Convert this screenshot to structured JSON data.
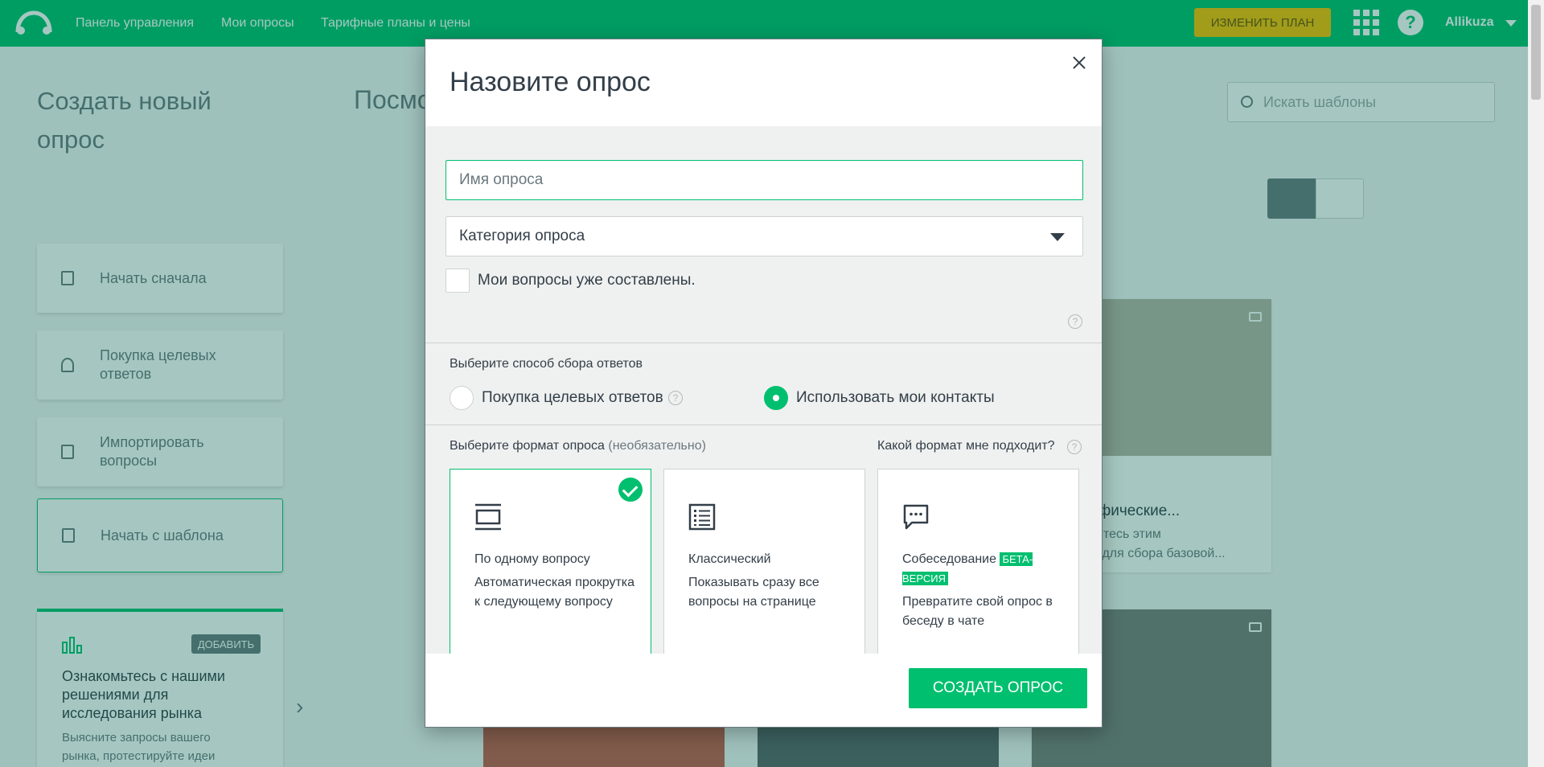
{
  "topbar": {
    "nav": [
      "Панель управления",
      "Мои опросы",
      "Тарифные планы и цены"
    ],
    "upgrade_label": "ИЗМЕНИТЬ ПЛАН",
    "help_label": "?",
    "user_name": "Allikuza"
  },
  "sidebar": {
    "title": "Создать новый опрос",
    "items": [
      {
        "label": "Начать сначала"
      },
      {
        "label": "Покупка целевых ответов"
      },
      {
        "label": "Импортировать вопросы"
      },
      {
        "label": "Начать с шаблона"
      }
    ],
    "market": {
      "badge": "ДОБАВИТЬ",
      "title": "Ознакомьтесь с нашими решениями для исследования рынка",
      "desc": "Выясните запросы вашего рынка, протестируйте идеи"
    }
  },
  "main": {
    "title": "Посмо",
    "search_placeholder": "Искать шаблоны",
    "template": {
      "name": "афические...",
      "desc_line1": "уйтесь этим",
      "desc_line2": "м для сбора базовой..."
    }
  },
  "modal": {
    "title": "Назовите опрос",
    "name_placeholder": "Имя опроса",
    "category_label": "Категория опроса",
    "own_questions_label": "Мои вопросы уже составлены.",
    "collect_label": "Выберите способ сбора ответов",
    "collect_options": [
      {
        "label": "Покупка целевых ответов",
        "checked": false
      },
      {
        "label": "Использовать мои контакты",
        "checked": true
      }
    ],
    "format_label": "Выберите формат опроса",
    "format_optional": "(необязательно)",
    "format_help": "Какой формат мне подходит?",
    "formats": [
      {
        "name": "По одному вопросу",
        "desc": "Автоматическая прокрутка к следующему вопросу",
        "selected": true,
        "icon": "one-question-icon"
      },
      {
        "name": "Классический",
        "desc": "Показывать сразу все вопросы на странице",
        "selected": false,
        "icon": "classic-list-icon"
      },
      {
        "name": "Собеседование",
        "badge": "БЕТА-ВЕРСИЯ",
        "desc": "Превратите свой опрос в беседу в чате",
        "selected": false,
        "icon": "chat-bubble-icon"
      }
    ],
    "create_button": "СОЗДАТЬ ОПРОС"
  },
  "colors": {
    "brand": "#00bf6f",
    "overlay": "#005e4c",
    "text": "#333e48",
    "muted": "#6b787f"
  }
}
